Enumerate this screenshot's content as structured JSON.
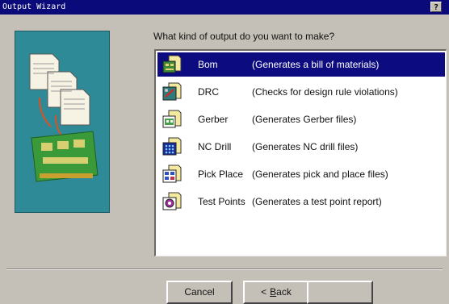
{
  "window": {
    "title": "Output Wizard",
    "help_label": "?"
  },
  "prompt": "What kind of output do you want to make?",
  "outputs": [
    {
      "name": "Bom",
      "description": "(Generates a bill of materials)",
      "icon": "bom-icon",
      "selected": true
    },
    {
      "name": "DRC",
      "description": "(Checks for design rule violations)",
      "icon": "drc-icon",
      "selected": false
    },
    {
      "name": "Gerber",
      "description": "(Generates Gerber files)",
      "icon": "gerber-icon",
      "selected": false
    },
    {
      "name": "NC Drill",
      "description": "(Generates NC drill files)",
      "icon": "nc-drill-icon",
      "selected": false
    },
    {
      "name": "Pick Place",
      "description": "(Generates pick and place files)",
      "icon": "pick-place-icon",
      "selected": false
    },
    {
      "name": "Test Points",
      "description": "(Generates a test point report)",
      "icon": "test-points-icon",
      "selected": false
    }
  ],
  "buttons": {
    "cancel": "Cancel",
    "back_prefix": "<",
    "back_hotkey": "B",
    "back_rest": "ack",
    "next": ""
  },
  "colors": {
    "titlebar": "#0a0a7a",
    "selection": "#0c0c80",
    "art_panel": "#2f8a97",
    "window_bg": "#c4c0b8"
  }
}
